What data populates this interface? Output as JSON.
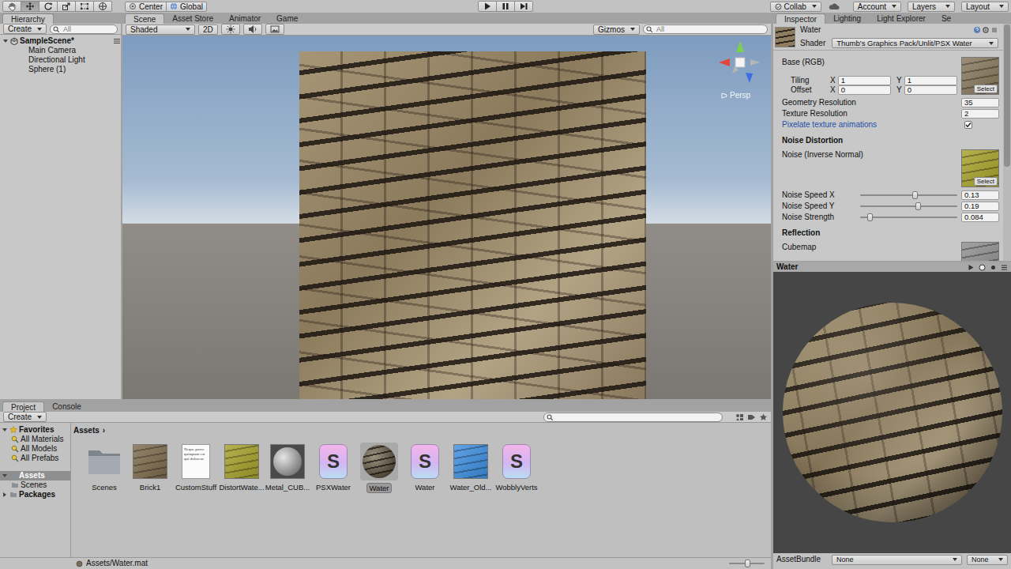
{
  "toolbar": {
    "tools": [
      {
        "kind": "hand",
        "selected": false
      },
      {
        "kind": "move",
        "selected": true
      },
      {
        "kind": "rotate",
        "selected": false
      },
      {
        "kind": "scale",
        "selected": false
      },
      {
        "kind": "rect",
        "selected": false
      },
      {
        "kind": "transform",
        "selected": false
      }
    ],
    "pivot": [
      "Center",
      "Global"
    ],
    "playback": [
      {
        "kind": "play",
        "selected": false
      },
      {
        "kind": "pause",
        "selected": false
      },
      {
        "kind": "step",
        "selected": false
      }
    ],
    "collab": "Collab",
    "account": "Account",
    "layers": "Layers",
    "layout": "Layout"
  },
  "hierarchy": {
    "tab": "Hierarchy",
    "create": "Create",
    "search_placeholder": "All",
    "scene": {
      "label": "SampleScene*",
      "expanded": true
    },
    "items": [
      {
        "label": "Main Camera",
        "selected": false
      },
      {
        "label": "Directional Light",
        "selected": false
      },
      {
        "label": "Sphere (1)",
        "selected": false
      }
    ]
  },
  "scene_tabs": [
    {
      "label": "Scene",
      "selected": true
    },
    {
      "label": "Asset Store",
      "selected": false
    },
    {
      "label": "Animator",
      "selected": false
    },
    {
      "label": "Game",
      "selected": false
    }
  ],
  "scene_toolbar": {
    "shading": "Shaded",
    "mode_2d": {
      "label": "2D",
      "on": false
    },
    "gizmos": "Gizmos",
    "search_placeholder": "All"
  },
  "scene_view": {
    "projection": "Persp"
  },
  "inspector_tabs": [
    {
      "label": "Inspector",
      "selected": true
    },
    {
      "label": "Lighting",
      "selected": false
    },
    {
      "label": "Light Explorer",
      "selected": false
    },
    {
      "label": "Se",
      "selected": false
    }
  ],
  "material": {
    "name": "Water",
    "shader_label": "Shader",
    "shader": "Thumb's Graphics Pack/Unlit/PSX Water"
  },
  "properties": [
    {
      "kind": "texture",
      "label": "Base (RGB)",
      "button": "Select",
      "color": "#85765a"
    },
    {
      "kind": "vector",
      "label": "Tiling",
      "x_label": "X",
      "x": "1",
      "y_label": "Y",
      "y": "1"
    },
    {
      "kind": "vector",
      "label": "Offset",
      "x_label": "X",
      "x": "0",
      "y_label": "Y",
      "y": "0"
    },
    {
      "kind": "field",
      "label": "Geometry Resolution",
      "value": "35"
    },
    {
      "kind": "field",
      "label": "Texture Resolution",
      "value": "2"
    },
    {
      "kind": "toggle",
      "label": "Pixelate texture animations",
      "checked": true
    },
    {
      "kind": "header",
      "label": "Noise Distortion"
    },
    {
      "kind": "texture",
      "label": "Noise (Inverse Normal)",
      "button": "Select",
      "color": "#a5a12a"
    },
    {
      "kind": "slider",
      "label": "Noise Speed X",
      "level": 0.56,
      "value": "0.13"
    },
    {
      "kind": "slider",
      "label": "Noise Speed Y",
      "level": 0.59,
      "value": "0.19"
    },
    {
      "kind": "slider",
      "label": "Noise Strength",
      "level": 0.1,
      "value": "0.084"
    },
    {
      "kind": "header",
      "label": "Reflection"
    },
    {
      "kind": "texture",
      "label": "Cubemap",
      "color": "#8e8e8e"
    }
  ],
  "preview": {
    "title": "Water",
    "asset_bundle_label": "AssetBundle",
    "bundle": "None",
    "variant": "None"
  },
  "project": {
    "tabs": [
      {
        "label": "Project",
        "selected": true
      },
      {
        "label": "Console",
        "selected": false
      }
    ],
    "create": "Create",
    "tree": [
      {
        "label": "Favorites",
        "kind": "favorites",
        "expanded": true,
        "selected": false
      },
      {
        "label": "All Materials",
        "kind": "search",
        "selected": false
      },
      {
        "label": "All Models",
        "kind": "search",
        "selected": false
      },
      {
        "label": "All Prefabs",
        "kind": "search",
        "selected": false
      },
      {
        "label": "Assets",
        "kind": "root-folder",
        "expanded": true,
        "selected": true
      },
      {
        "label": "Scenes",
        "kind": "folder",
        "selected": false
      },
      {
        "label": "Packages",
        "kind": "root-folder",
        "expanded": false,
        "selected": false
      }
    ],
    "breadcrumb": "Assets",
    "breadcrumb_sep": "›",
    "assets": [
      {
        "label": "Scenes",
        "kind": "folder",
        "selected": false
      },
      {
        "label": "Brick1",
        "kind": "texture",
        "color": "#7d6a4c",
        "selected": false
      },
      {
        "label": "CustomStuff",
        "kind": "text",
        "preview": "Neque porro quisquam est qui dolorem.",
        "selected": false
      },
      {
        "label": "DistortWate...",
        "kind": "texture",
        "color": "#a5a12a",
        "selected": false
      },
      {
        "label": "Metal_CUB...",
        "kind": "cubemap",
        "color": "#9a9a9a",
        "selected": false
      },
      {
        "label": "PSXWater",
        "kind": "shader",
        "glyph": "S",
        "selected": false
      },
      {
        "label": "Water",
        "kind": "material",
        "color": "#7a6d55",
        "selected": true
      },
      {
        "label": "Water",
        "kind": "shader",
        "glyph": "S",
        "selected": false
      },
      {
        "label": "Water_Old...",
        "kind": "texture",
        "color": "#3d8ee0",
        "selected": false
      },
      {
        "label": "WobblyVerts",
        "kind": "shader",
        "glyph": "S",
        "selected": false
      }
    ],
    "path": "Assets/Water.mat",
    "zoom_level": 0.5
  }
}
